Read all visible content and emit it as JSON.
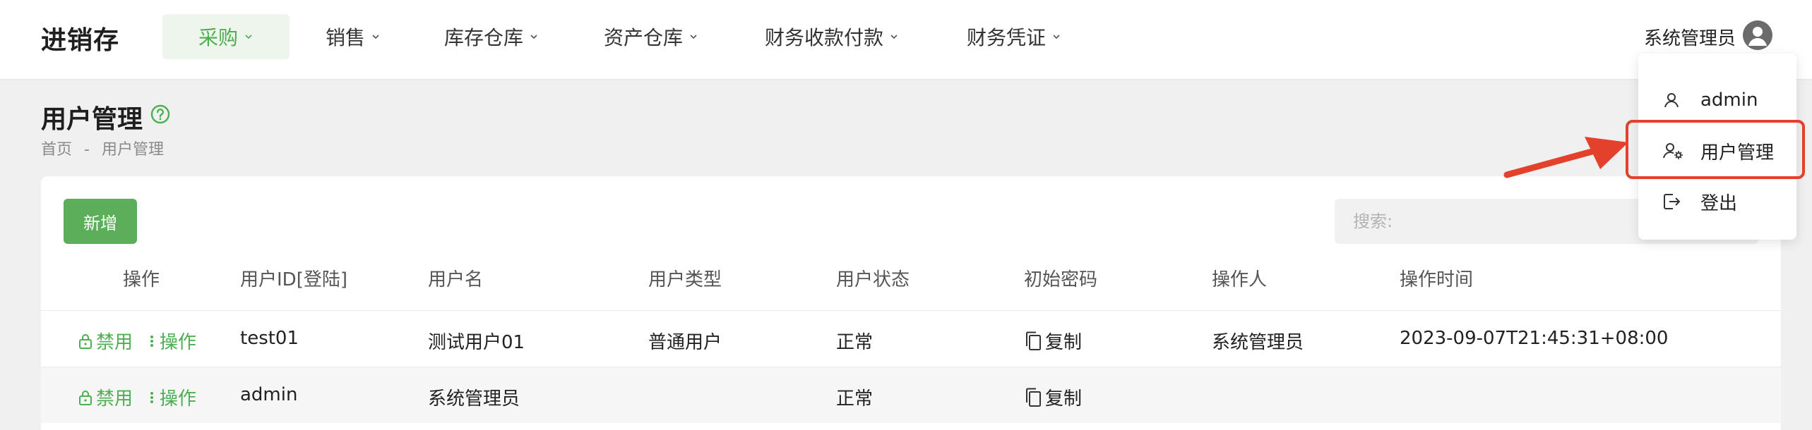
{
  "app": {
    "brand": "进销存"
  },
  "nav": {
    "items": [
      {
        "label": "采购",
        "active": true
      },
      {
        "label": "销售"
      },
      {
        "label": "库存仓库"
      },
      {
        "label": "资产仓库"
      },
      {
        "label": "财务收款付款"
      },
      {
        "label": "财务凭证"
      }
    ]
  },
  "user": {
    "name": "系统管理员"
  },
  "page": {
    "title": "用户管理",
    "breadcrumb": {
      "home": "首页",
      "sep": "-",
      "current": "用户管理"
    }
  },
  "toolbar": {
    "add_label": "新增",
    "search_placeholder": "搜索:"
  },
  "table": {
    "headers": [
      "操作",
      "用户ID[登陆]",
      "用户名",
      "用户类型",
      "用户状态",
      "初始密码",
      "操作人",
      "操作时间"
    ],
    "action_disable": "禁用",
    "action_more": "操作",
    "copy_label": "复制",
    "rows": [
      {
        "id": "test01",
        "name": "测试用户01",
        "type": "普通用户",
        "status": "正常",
        "operator": "系统管理员",
        "time": "2023-09-07T21:45:31+08:00"
      },
      {
        "id": "admin",
        "name": "系统管理员",
        "type": "",
        "status": "正常",
        "operator": "",
        "time": ""
      }
    ]
  },
  "dropdown": {
    "items": [
      {
        "label": "admin",
        "icon": "user-icon"
      },
      {
        "label": "用户管理",
        "icon": "user-settings-icon"
      },
      {
        "label": "登出",
        "icon": "logout-icon"
      }
    ]
  },
  "colors": {
    "accent": "#4caf50",
    "highlight": "#e4412d"
  }
}
